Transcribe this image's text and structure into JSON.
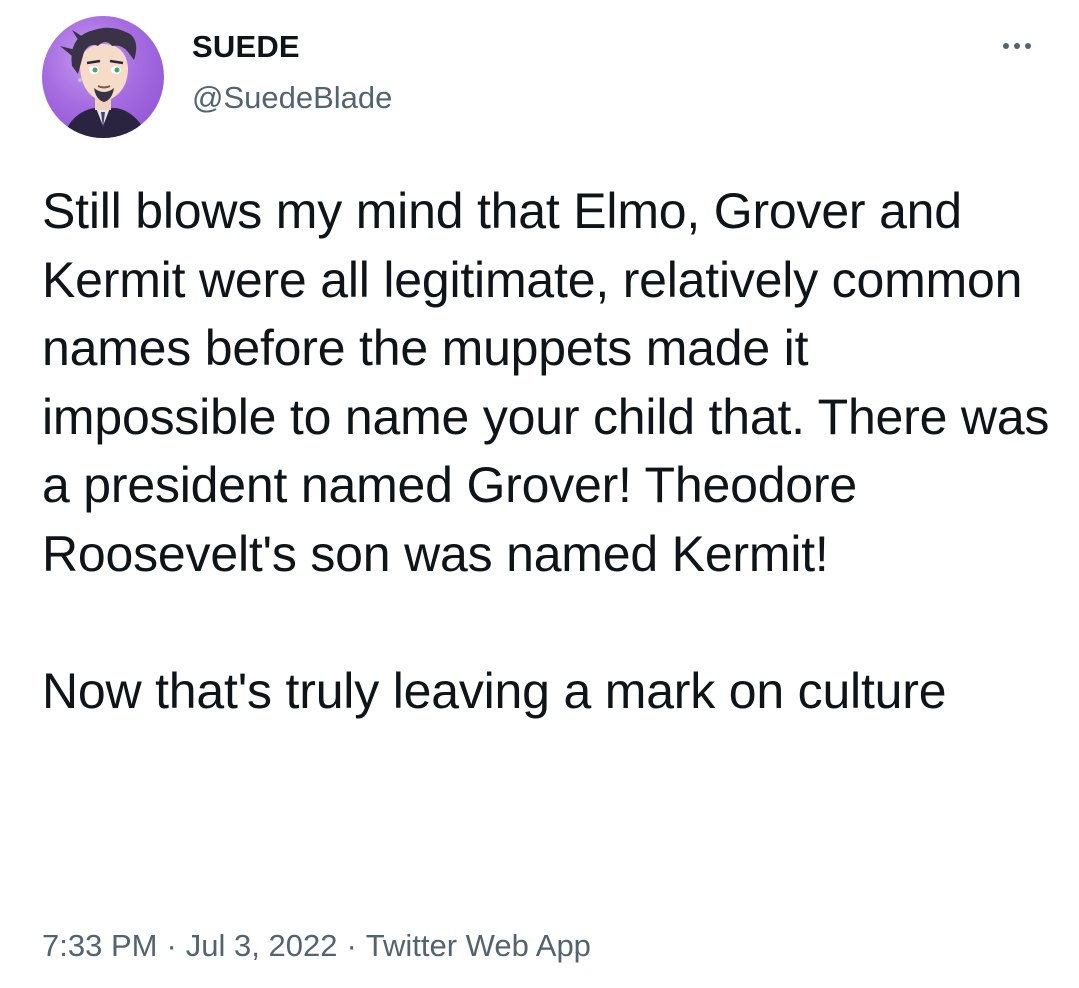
{
  "author": {
    "display_name": "SUEDE",
    "handle": "@SuedeBlade",
    "avatar_icon": "avatar-illustration",
    "avatar_bg": "#a56be0"
  },
  "header": {
    "more_icon": "more-horizontal-icon"
  },
  "tweet": {
    "text": "Still blows my mind that Elmo, Grover and Kermit were all legitimate, relatively common names before the muppets made it impossible to name your child that. There was a president named Grover! Theodore Roosevelt's son was named Kermit!\n\nNow that's truly leaving a mark on culture"
  },
  "meta": {
    "time": "7:33 PM",
    "separator": "·",
    "date": "Jul 3, 2022",
    "source": "Twitter Web App"
  },
  "colors": {
    "text_primary": "#0f1419",
    "text_secondary": "#536471",
    "background": "#ffffff"
  }
}
